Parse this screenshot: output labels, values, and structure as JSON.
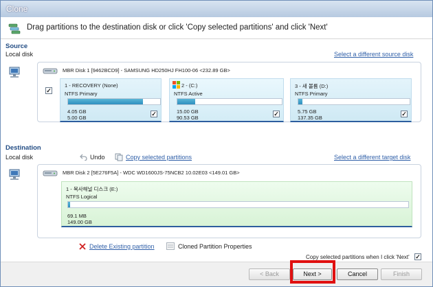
{
  "window": {
    "title": "Clone"
  },
  "header": {
    "instruction": "Drag partitions to the destination disk or click 'Copy selected partitions' and click 'Next'"
  },
  "source": {
    "section_title": "Source",
    "sub_label": "Local disk",
    "select_link": "Select a different source disk",
    "disk_label": "MBR Disk 1 [9462BCD9] - SAMSUNG HD250HJ FH100-06   <232.89 GB>",
    "disk_selected": true,
    "partitions": [
      {
        "name": "1 - RECOVERY (None)",
        "type": "NTFS Primary",
        "used": "4.05 GB",
        "total": "5.00 GB",
        "fill": 0.81,
        "checked": true,
        "os_icon": false
      },
      {
        "name": "2 -  (C:)",
        "type": "NTFS Active",
        "used": "15.00 GB",
        "total": "90.53 GB",
        "fill": 0.17,
        "checked": true,
        "os_icon": true
      },
      {
        "name": "3 - 새 볼륨 (D:)",
        "type": "NTFS Primary",
        "used": "5.75 GB",
        "total": "137.35 GB",
        "fill": 0.04,
        "checked": true,
        "os_icon": false
      }
    ]
  },
  "destination": {
    "section_title": "Destination",
    "sub_label": "Local disk",
    "undo_label": "Undo",
    "copy_label": "Copy selected partitions",
    "select_link": "Select a different target disk",
    "disk_label": "MBR Disk 2 [5E276F5A] - WDC WD1600JS-75NCB2 10.02E03   <149.01 GB>",
    "partition": {
      "name": "1 - 복사해널 디스크 (E:)",
      "type": "NTFS Logical",
      "used": "69.1 MB",
      "total": "149.00 GB",
      "fill": 0.0005
    },
    "delete_label": "Delete Existing partition",
    "properties_label": "Cloned Partition Properties"
  },
  "options": {
    "copy_on_next_label": "Copy selected partitions when I click 'Next'",
    "copy_on_next_checked": true
  },
  "buttons": {
    "back": "< Back",
    "next": "Next >",
    "cancel": "Cancel",
    "finish": "Finish"
  },
  "colors": {
    "accent": "#2f5fa8",
    "highlight": "#e01010",
    "bar": "#2f8fbf"
  },
  "icons": {
    "header": "clone-icon",
    "computer": "computer-icon",
    "disk": "disk-drive-icon",
    "undo": "undo-arrow-icon",
    "copy": "copy-icon",
    "delete": "delete-x-icon",
    "properties": "properties-icon",
    "windows": "windows-logo-icon"
  }
}
